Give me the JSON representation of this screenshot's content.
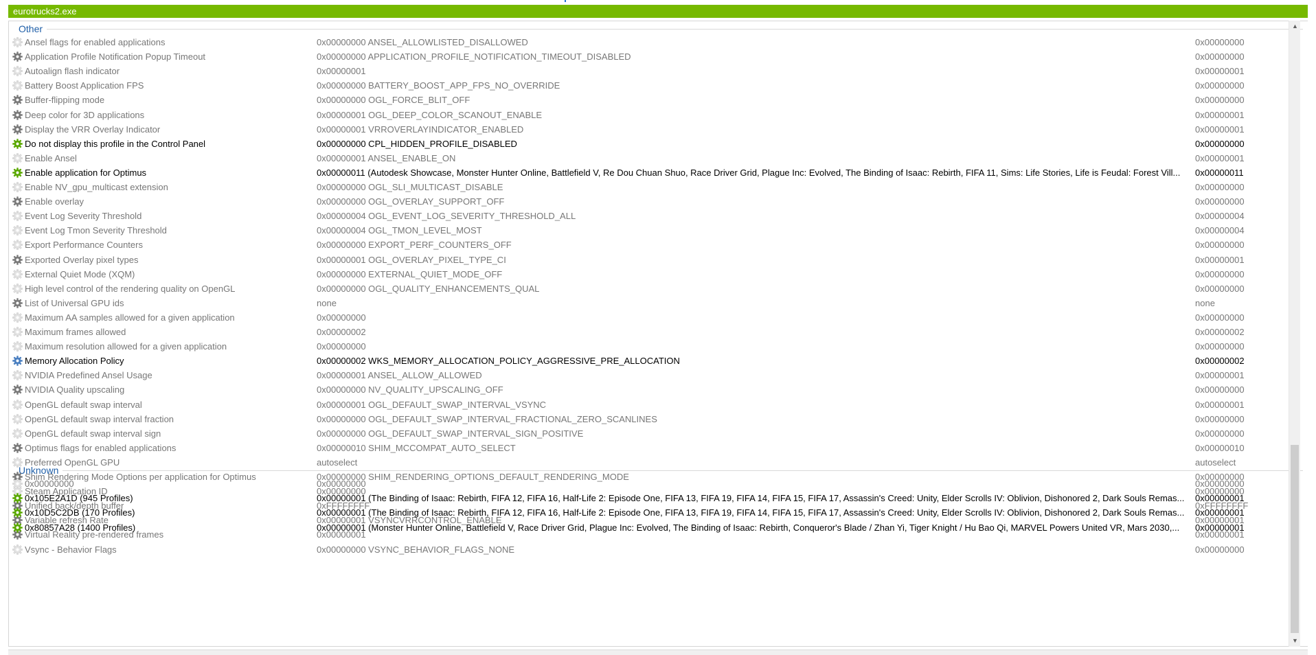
{
  "window": {
    "process_label": "eurotrucks2.exe"
  },
  "colors": {
    "accent": "#76b900",
    "group_title": "#1f5fa8",
    "icon_grey": "#7a7a7a",
    "icon_green": "#5aa800",
    "icon_blue": "#4a7fc0"
  },
  "groups": [
    {
      "title": "Other"
    },
    {
      "title": "Unknown"
    }
  ],
  "rows": [
    {
      "name": "Ansel flags for enabled applications",
      "value": "0x00000000 ANSEL_ALLOWLISTED_DISALLOWED",
      "default": "0x00000000",
      "icon": "gear-light-icon",
      "bold": false
    },
    {
      "name": "Application Profile Notification Popup Timeout",
      "value": "0x00000000 APPLICATION_PROFILE_NOTIFICATION_TIMEOUT_DISABLED",
      "default": "0x00000000",
      "icon": "gear-icon",
      "bold": false
    },
    {
      "name": "Autoalign flash indicator",
      "value": "0x00000001",
      "default": "0x00000001",
      "icon": "gear-light-icon",
      "bold": false
    },
    {
      "name": "Battery Boost Application FPS",
      "value": "0x00000000 BATTERY_BOOST_APP_FPS_NO_OVERRIDE",
      "default": "0x00000000",
      "icon": "gear-light-icon",
      "bold": false
    },
    {
      "name": "Buffer-flipping mode",
      "value": "0x00000000 OGL_FORCE_BLIT_OFF",
      "default": "0x00000000",
      "icon": "gear-icon",
      "bold": false
    },
    {
      "name": "Deep color for 3D applications",
      "value": "0x00000001 OGL_DEEP_COLOR_SCANOUT_ENABLE",
      "default": "0x00000001",
      "icon": "gear-icon",
      "bold": false
    },
    {
      "name": "Display the VRR Overlay Indicator",
      "value": "0x00000001 VRROVERLAYINDICATOR_ENABLED",
      "default": "0x00000001",
      "icon": "gear-icon",
      "bold": false
    },
    {
      "name": "Do not display this profile in the Control Panel",
      "value": "0x00000000 CPL_HIDDEN_PROFILE_DISABLED",
      "default": "0x00000000",
      "icon": "gear-green-icon",
      "bold": true
    },
    {
      "name": "Enable Ansel",
      "value": "0x00000001 ANSEL_ENABLE_ON",
      "default": "0x00000001",
      "icon": "gear-light-icon",
      "bold": false
    },
    {
      "name": "Enable application for Optimus",
      "value": "0x00000011 (Autodesk Showcase, Monster Hunter Online, Battlefield V, Re Dou Chuan Shuo, Race Driver Grid, Plague Inc: Evolved, The Binding of Isaac: Rebirth, FIFA 11, Sims: Life Stories, Life is Feudal: Forest Vill...",
      "default": "0x00000011",
      "icon": "gear-green-icon",
      "bold": true
    },
    {
      "name": "Enable NV_gpu_multicast extension",
      "value": "0x00000000 OGL_SLI_MULTICAST_DISABLE",
      "default": "0x00000000",
      "icon": "gear-light-icon",
      "bold": false
    },
    {
      "name": "Enable overlay",
      "value": "0x00000000 OGL_OVERLAY_SUPPORT_OFF",
      "default": "0x00000000",
      "icon": "gear-icon",
      "bold": false
    },
    {
      "name": "Event Log Severity Threshold",
      "value": "0x00000004 OGL_EVENT_LOG_SEVERITY_THRESHOLD_ALL",
      "default": "0x00000004",
      "icon": "gear-light-icon",
      "bold": false
    },
    {
      "name": "Event Log Tmon Severity Threshold",
      "value": "0x00000004 OGL_TMON_LEVEL_MOST",
      "default": "0x00000004",
      "icon": "gear-light-icon",
      "bold": false
    },
    {
      "name": "Export Performance Counters",
      "value": "0x00000000 EXPORT_PERF_COUNTERS_OFF",
      "default": "0x00000000",
      "icon": "gear-light-icon",
      "bold": false
    },
    {
      "name": "Exported Overlay pixel types",
      "value": "0x00000001 OGL_OVERLAY_PIXEL_TYPE_CI",
      "default": "0x00000001",
      "icon": "gear-icon",
      "bold": false
    },
    {
      "name": "External Quiet Mode (XQM)",
      "value": "0x00000000 EXTERNAL_QUIET_MODE_OFF",
      "default": "0x00000000",
      "icon": "gear-light-icon",
      "bold": false
    },
    {
      "name": "High level control of the rendering quality on OpenGL",
      "value": "0x00000000 OGL_QUALITY_ENHANCEMENTS_QUAL",
      "default": "0x00000000",
      "icon": "gear-light-icon",
      "bold": false
    },
    {
      "name": "List of Universal GPU ids",
      "value": "none",
      "default": "none",
      "icon": "gear-icon",
      "bold": false
    },
    {
      "name": "Maximum AA samples allowed for a given application",
      "value": "0x00000000",
      "default": "0x00000000",
      "icon": "gear-light-icon",
      "bold": false
    },
    {
      "name": "Maximum frames allowed",
      "value": "0x00000002",
      "default": "0x00000002",
      "icon": "gear-light-icon",
      "bold": false
    },
    {
      "name": "Maximum resolution allowed for a given application",
      "value": "0x00000000",
      "default": "0x00000000",
      "icon": "gear-light-icon",
      "bold": false
    },
    {
      "name": "Memory Allocation Policy",
      "value": "0x00000002 WKS_MEMORY_ALLOCATION_POLICY_AGGRESSIVE_PRE_ALLOCATION",
      "default": "0x00000002",
      "icon": "gear-blue-icon",
      "bold": true
    },
    {
      "name": "NVIDIA Predefined Ansel Usage",
      "value": "0x00000001 ANSEL_ALLOW_ALLOWED",
      "default": "0x00000001",
      "icon": "gear-light-icon",
      "bold": false
    },
    {
      "name": "NVIDIA Quality upscaling",
      "value": "0x00000000 NV_QUALITY_UPSCALING_OFF",
      "default": "0x00000000",
      "icon": "gear-icon",
      "bold": false
    },
    {
      "name": "OpenGL default swap interval",
      "value": "0x00000001 OGL_DEFAULT_SWAP_INTERVAL_VSYNC",
      "default": "0x00000001",
      "icon": "gear-light-icon",
      "bold": false
    },
    {
      "name": "OpenGL default swap interval fraction",
      "value": "0x00000000 OGL_DEFAULT_SWAP_INTERVAL_FRACTIONAL_ZERO_SCANLINES",
      "default": "0x00000000",
      "icon": "gear-light-icon",
      "bold": false
    },
    {
      "name": "OpenGL default swap interval sign",
      "value": "0x00000000 OGL_DEFAULT_SWAP_INTERVAL_SIGN_POSITIVE",
      "default": "0x00000000",
      "icon": "gear-light-icon",
      "bold": false
    },
    {
      "name": "Optimus flags for enabled applications",
      "value": "0x00000010 SHIM_MCCOMPAT_AUTO_SELECT",
      "default": "0x00000010",
      "icon": "gear-icon",
      "bold": false
    },
    {
      "name": "Preferred OpenGL GPU",
      "value": "autoselect",
      "default": "autoselect",
      "icon": "gear-light-icon",
      "bold": false
    },
    {
      "name": "Shim Rendering Mode Options per application for Optimus",
      "value": "0x00000000 SHIM_RENDERING_OPTIONS_DEFAULT_RENDERING_MODE",
      "default": "0x00000000",
      "icon": "gear-icon",
      "bold": false
    },
    {
      "name": "Steam Application ID",
      "value": "0x00000000",
      "default": "0x00000000",
      "icon": "gear-light-icon",
      "bold": false
    },
    {
      "name": "Unified back/depth buffer",
      "value": "0xFFFFFFFF",
      "default": "0xFFFFFFFF",
      "icon": "gear-icon",
      "bold": false
    },
    {
      "name": "Variable refresh Rate",
      "value": "0x00000001 VSYNCVRRCONTROL_ENABLE",
      "default": "0x00000001",
      "icon": "gear-icon",
      "bold": false
    },
    {
      "name": "Virtual Reality pre-rendered frames",
      "value": "0x00000001",
      "default": "0x00000001",
      "icon": "gear-icon",
      "bold": false
    },
    {
      "name": "Vsync - Behavior Flags",
      "value": "0x00000000 VSYNC_BEHAVIOR_FLAGS_NONE",
      "default": "0x00000000",
      "icon": "gear-light-icon",
      "bold": false
    },
    {
      "name": "0x00000000",
      "value": "0x00000000",
      "default": "0x00000000",
      "icon": "gear-light-icon",
      "bold": false
    },
    {
      "name": "0x105E2A1D (945 Profiles)",
      "value": "0x00000001 (The Binding of Isaac: Rebirth, FIFA 12, FIFA 16, Half-Life 2: Episode One, FIFA 13, FIFA 19, FIFA 14, FIFA 15, FIFA 17, Assassin's Creed: Unity, Elder Scrolls IV: Oblivion, Dishonored 2, Dark Souls Remas...",
      "default": "0x00000001",
      "icon": "gear-green-icon",
      "bold": true
    },
    {
      "name": "0x10D5C2DB (170 Profiles)",
      "value": "0x00000001 (The Binding of Isaac: Rebirth, FIFA 12, FIFA 16, Half-Life 2: Episode One, FIFA 13, FIFA 19, FIFA 14, FIFA 15, FIFA 17, Assassin's Creed: Unity, Elder Scrolls IV: Oblivion, Dishonored 2, Dark Souls Remas...",
      "default": "0x00000001",
      "icon": "gear-green-icon",
      "bold": true
    },
    {
      "name": "0x80857A28 (1400 Profiles)",
      "value": "0x00000001 (Monster Hunter Online, Battlefield V, Race Driver Grid, Plague Inc: Evolved, The Binding of Isaac: Rebirth, Conqueror's Blade / Zhan Yi, Tiger Knight / Hu Bao Qi, MARVEL Powers United VR, Mars 2030,...",
      "default": "0x00000001",
      "icon": "gear-green-icon",
      "bold": true
    }
  ]
}
